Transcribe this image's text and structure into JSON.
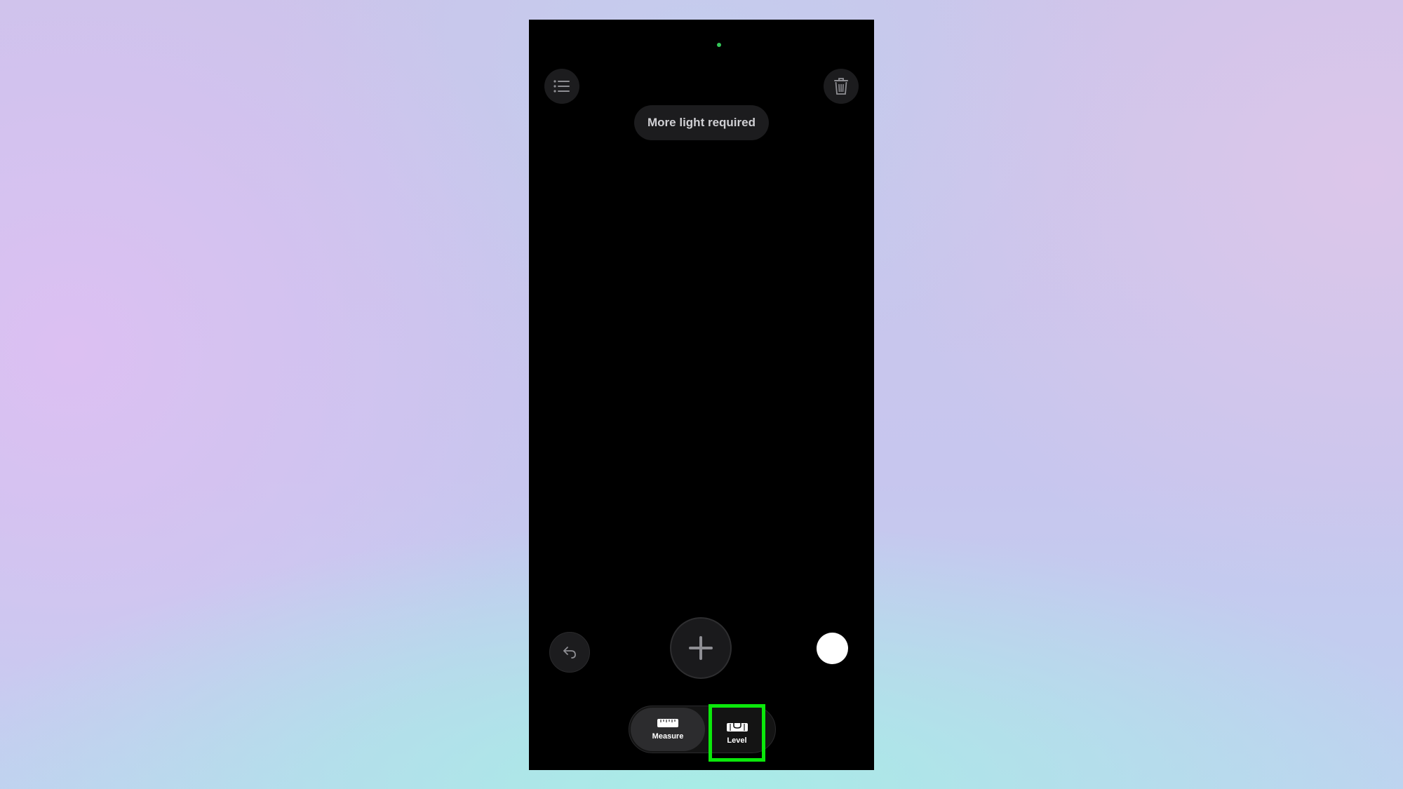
{
  "screen": {
    "hint": "More light required"
  },
  "modes": [
    {
      "label": "Measure",
      "icon": "ruler-icon",
      "selected": true
    },
    {
      "label": "Level",
      "icon": "level-icon",
      "selected": false,
      "highlighted": true
    }
  ],
  "icons": {
    "top_left": "list-icon",
    "top_right": "trash-icon",
    "bottom_left": "undo-icon",
    "center": "plus-icon",
    "bottom_right": "shutter-button"
  },
  "colors": {
    "camera_indicator": "#34c759",
    "highlight_box": "#0be80b"
  }
}
